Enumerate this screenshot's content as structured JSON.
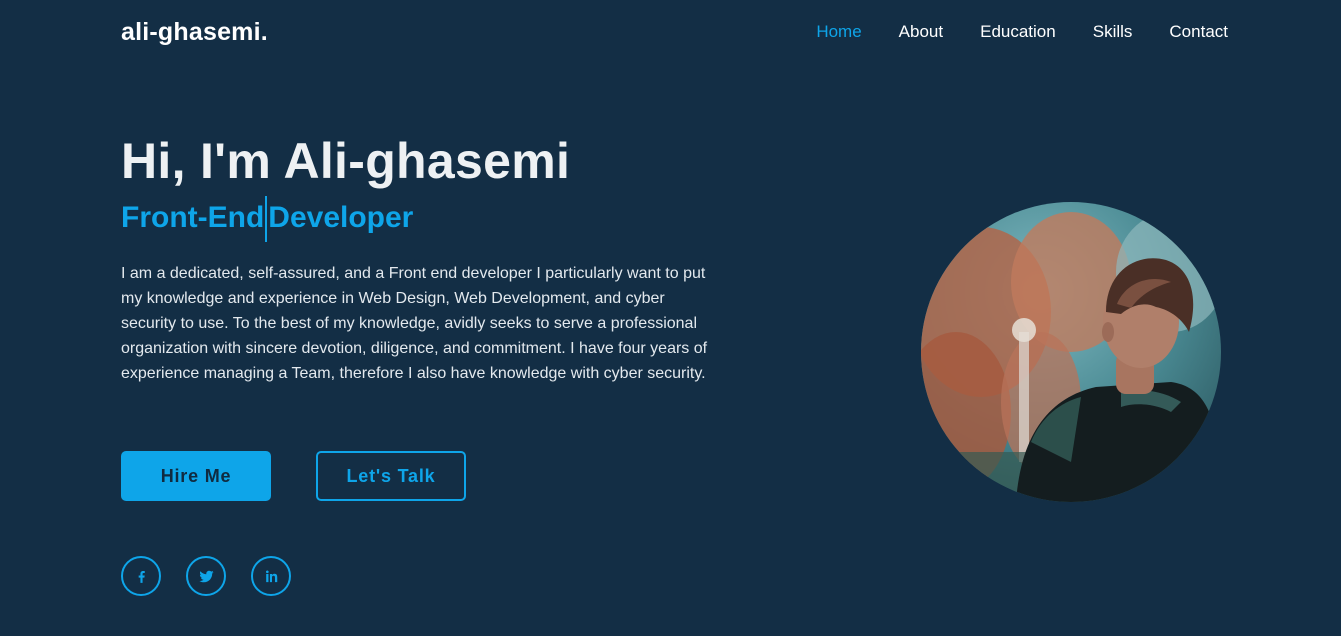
{
  "header": {
    "logo": "ali-ghasemi.",
    "nav": [
      "Home",
      "About",
      "Education",
      "Skills",
      "Contact"
    ],
    "active_nav": "Home"
  },
  "hero": {
    "greeting": "Hi, I'm Ali-ghasemi",
    "role_part1": "Front-End",
    "role_part2": "Developer",
    "description": "I am a dedicated, self-assured, and a Front end developer I particularly want to put my knowledge and experience in Web Design, Web Development, and cyber security to use. To the best of my knowledge, avidly seeks to serve a professional organization with sincere devotion, diligence, and commitment. I have four years of experience managing a Team, therefore I also have knowledge with cyber security.",
    "hire_label": "Hire Me",
    "talk_label": "Let's Talk"
  },
  "social": {
    "icons": [
      "facebook-icon",
      "twitter-icon",
      "linkedin-icon"
    ]
  },
  "colors": {
    "background": "#132e45",
    "accent": "#0ea5e9",
    "text": "#ffffff"
  }
}
